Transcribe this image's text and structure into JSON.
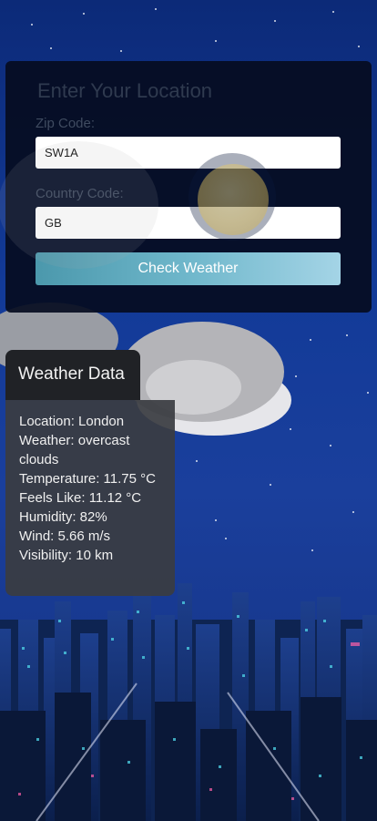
{
  "form": {
    "title": "Enter Your Location",
    "zip_label": "Zip Code:",
    "zip_value": "SW1A",
    "country_label": "Country Code:",
    "country_value": "GB",
    "submit_label": "Check Weather"
  },
  "weather": {
    "title": "Weather Data",
    "location": "Location: London",
    "condition": "Weather: overcast clouds",
    "temperature": "Temperature: 11.75 °C",
    "feels_like": "Feels Like: 11.12 °C",
    "humidity": "Humidity: 82%",
    "wind": "Wind: 5.66 m/s",
    "visibility": "Visibility: 10 km"
  },
  "colors": {
    "sky": "#123a98",
    "panel": "#050c20",
    "button_start": "#4b98ac",
    "button_end": "#a4d4e6",
    "card": "#3a3c42"
  },
  "icons": {
    "moon": "moon-icon",
    "clouds": "cloud-icon"
  }
}
